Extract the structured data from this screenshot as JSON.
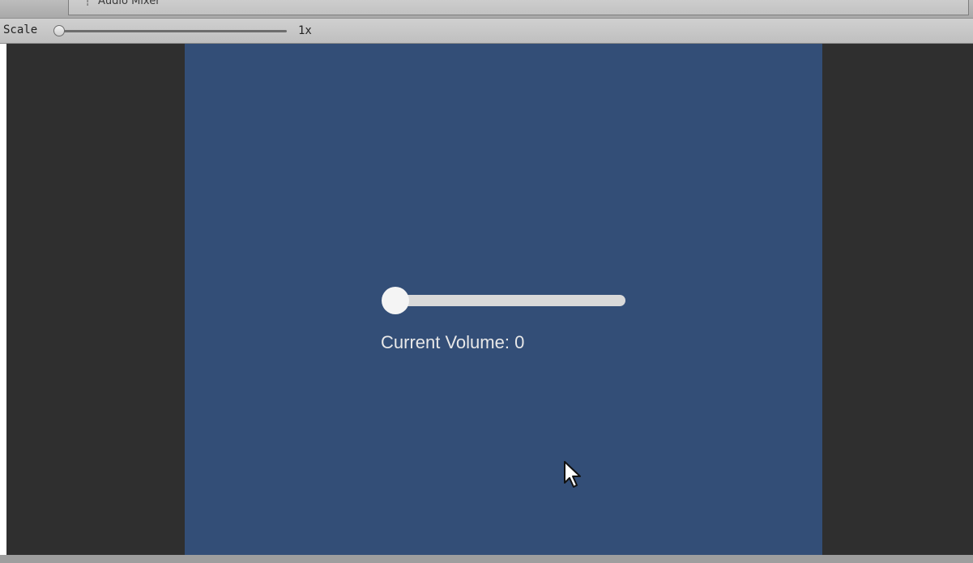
{
  "tab": {
    "label": "Audio Mixer",
    "icon": "audio-mixer-icon"
  },
  "toolbar": {
    "scale_label": "Scale",
    "scale_value": "1x",
    "scale_level": 0
  },
  "game": {
    "volume_slider_level": 0,
    "volume_text": "Current Volume: 0"
  },
  "colors": {
    "canvas_background": "#334e77",
    "viewport_background": "#2f2f2f",
    "slider_track": "#d9d9d9",
    "slider_knob": "#f4f4f4",
    "text": "#e8e8e8"
  }
}
